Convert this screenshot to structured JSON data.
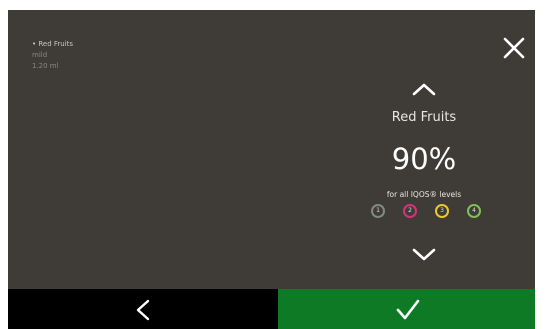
{
  "product": {
    "name": "Red Fruits",
    "variant": "mild",
    "volume": "1.20 ml"
  },
  "selector": {
    "flavor": "Red Fruits",
    "percentage": "90%",
    "levels_label": "for all IQOS® levels",
    "levels": [
      {
        "label": "1",
        "color": "#7f8a80"
      },
      {
        "label": "2",
        "color": "#d2337a"
      },
      {
        "label": "3",
        "color": "#e9c832"
      },
      {
        "label": "4",
        "color": "#7fc056"
      }
    ]
  },
  "icons": {
    "close": "close-icon",
    "up": "chevron-up-icon",
    "down": "chevron-down-icon",
    "back": "chevron-left-icon",
    "confirm": "checkmark-icon"
  },
  "colors": {
    "background": "#3f3c38",
    "footer_back": "#000000",
    "footer_confirm": "#0f7a25"
  }
}
